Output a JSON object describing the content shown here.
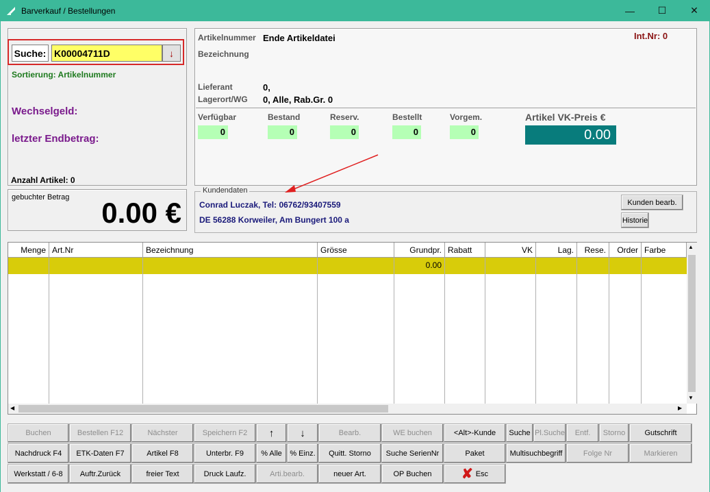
{
  "window": {
    "title": "Barverkauf / Bestellungen",
    "min": "—",
    "max": "☐",
    "close": "✕"
  },
  "search": {
    "label": "Suche:",
    "value": "K00004711D",
    "button": "↓"
  },
  "left": {
    "sort": "Sortierung: Artikelnummer",
    "wechselgeld": "Wechselgeld:",
    "endbetrag": "letzter Endbetrag:",
    "anzahl": "Anzahl Artikel: 0"
  },
  "amount": {
    "label": "gebuchter Betrag",
    "value": "0.00 €"
  },
  "article": {
    "artnr_label": "Artikelnummer",
    "artnr_value": "Ende Artikeldatei",
    "bez_label": "Bezeichnung",
    "intnr": "Int.Nr: 0",
    "lieferant_label": "Lieferant",
    "lieferant_value": "0,",
    "lagerort_label": "Lagerort/WG",
    "lagerort_value": "0, Alle, Rab.Gr. 0",
    "stock": [
      {
        "label": "Verfügbar",
        "value": "0"
      },
      {
        "label": "Bestand",
        "value": "0"
      },
      {
        "label": "Reserv.",
        "value": "0"
      },
      {
        "label": "Bestellt",
        "value": "0"
      },
      {
        "label": "Vorgem.",
        "value": "0"
      }
    ],
    "price_label": "Artikel VK-Preis €",
    "price_value": "0.00"
  },
  "customer": {
    "legend": "Kundendaten",
    "line1": "Conrad Luczak, Tel: 06762/93407559",
    "line2": "DE 56288 Korweiler, Am Bungert 100 a",
    "edit_btn": "Kunden bearb.",
    "history_btn": "Historie"
  },
  "grid": {
    "columns": [
      "Menge",
      "Art.Nr",
      "Bezeichnung",
      "Grösse",
      "Grundpr.",
      "Rabatt",
      "VK",
      "Lag.",
      "Rese.",
      "Order",
      "Farbe"
    ],
    "row": {
      "grundpr": "0.00"
    }
  },
  "buttons": {
    "row1": [
      "Buchen",
      "Bestellen F12",
      "Nächster",
      "Speichern F2",
      "↑",
      "↓",
      "Bearb.",
      "WE buchen",
      "<Alt>-Kunde",
      "Suche",
      "Pl.Suche",
      "Entf.",
      "Storno",
      "Gutschrift"
    ],
    "row2": [
      "Nachdruck F4",
      "ETK-Daten F7",
      "Artikel F8",
      "Unterbr. F9",
      "% Alle",
      "% Einz.",
      "Quitt. Storno",
      "Suche SerienNr",
      "Paket",
      "Multisuchbegriff",
      "Folge Nr",
      "Markieren"
    ],
    "row3": [
      "Werkstatt / 6-8",
      "Auftr.Zurück",
      "freier Text",
      "Druck Laufz.",
      "Arti.bearb.",
      "neuer Art.",
      "OP Buchen",
      "Esc"
    ]
  },
  "colors": {
    "titlebar": "#3cb99a",
    "price_bg": "#087c7c",
    "grid_row": "#d8cc0a",
    "stock_bg": "#b5ffb5",
    "search_bg": "#ffff66"
  }
}
